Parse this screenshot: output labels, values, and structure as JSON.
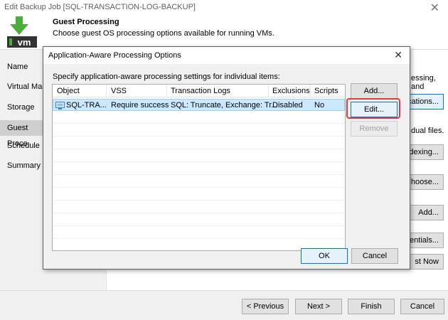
{
  "window": {
    "title": "Edit Backup Job [SQL-TRANSACTION-LOG-BACKUP]",
    "close_glyph": "✕"
  },
  "header": {
    "logo_icon": "vm-download-icon",
    "logo_text": "vm",
    "title": "Guest Processing",
    "subtitle": "Choose guest OS processing options available for running VMs."
  },
  "nav": {
    "items": [
      {
        "label": "Name",
        "selected": false
      },
      {
        "label": "Virtual Mac",
        "selected": false
      },
      {
        "label": "Storage",
        "selected": false
      },
      {
        "label": "Guest Proce",
        "selected": true
      },
      {
        "label": "Schedule",
        "selected": false
      },
      {
        "label": "Summary",
        "selected": false
      }
    ]
  },
  "background_right": {
    "frag_processing": "essing, and",
    "btn_applications": "ications...",
    "frag_files": "dual files.",
    "btn_indexing": "dexing...",
    "btn_choose": "hoose...",
    "btn_add": "Add...",
    "btn_credentials": "dentials...",
    "btn_test_now": "st Now"
  },
  "footer": {
    "previous": "< Previous",
    "next": "Next >",
    "finish": "Finish",
    "cancel": "Cancel"
  },
  "dialog": {
    "title": "Application-Aware Processing Options",
    "close_glyph": "✕",
    "description": "Specify application-aware processing settings for individual items:",
    "columns": [
      "Object",
      "VSS",
      "Transaction Logs",
      "Exclusions",
      "Scripts"
    ],
    "rows": [
      {
        "object": "SQL-TRA...",
        "vss": "Require success",
        "transaction_logs": "SQL: Truncate, Exchange: Tr...",
        "exclusions": "Disabled",
        "scripts": "No",
        "selected": true
      }
    ],
    "buttons": {
      "add": "Add...",
      "edit": "Edit...",
      "remove": "Remove",
      "ok": "OK",
      "cancel": "Cancel"
    }
  },
  "colors": {
    "selection_bg": "#cce8ff",
    "highlight": "#e03c3c",
    "veeam_green": "#4cae3a"
  }
}
